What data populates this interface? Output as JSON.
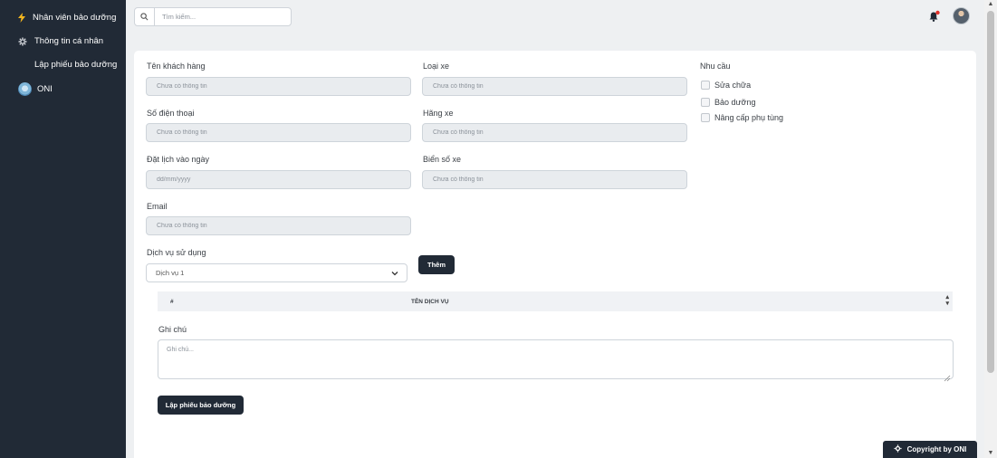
{
  "sidebar": {
    "items": [
      {
        "label": "Nhân viên bảo dưỡng",
        "icon": "bolt-icon"
      },
      {
        "label": "Thông tin cá nhân",
        "icon": "gear-icon"
      },
      {
        "label": "Lập phiếu bảo dưỡng",
        "icon": ""
      },
      {
        "label": "ONI",
        "icon": "avatar"
      }
    ]
  },
  "header": {
    "search_placeholder": "Tìm kiếm...",
    "accent_color": "#e0322b"
  },
  "form": {
    "customer_name_label": "Tên khách hàng",
    "customer_name_placeholder": "Chưa có thông tin",
    "phone_label": "Số điện thoại",
    "phone_placeholder": "Chưa có thông tin",
    "date_label": "Đặt lịch vào ngày",
    "date_placeholder": "dd/mm/yyyy",
    "email_label": "Email",
    "email_placeholder": "Chưa có thông tin",
    "car_type_label": "Loại xe",
    "car_type_placeholder": "Chưa có thông tin",
    "car_brand_label": "Hãng xe",
    "car_brand_placeholder": "Chưa có thông tin",
    "plate_label": "Biển số xe",
    "plate_placeholder": "Chưa có thông tin",
    "needs_label": "Nhu cầu",
    "needs": [
      "Sửa chữa",
      "Bảo dưỡng",
      "Nâng cấp phụ tùng"
    ],
    "service_label": "Dịch vụ sử dụng",
    "service_selected": "Dịch vụ 1",
    "add_button": "Thêm",
    "table_headers": [
      "#",
      "TÊN DỊCH VỤ"
    ],
    "note_label": "Ghi chú",
    "note_placeholder": "Ghi chú...",
    "submit_button": "Lập phiếu bảo dưỡng"
  },
  "footer": {
    "copyright": "Copyright by ONI"
  }
}
